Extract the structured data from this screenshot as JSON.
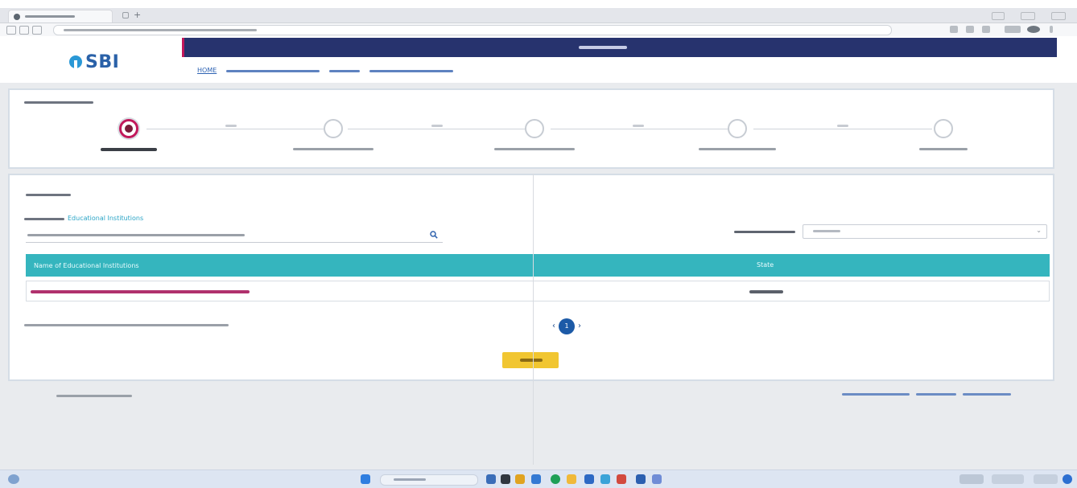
{
  "header": {
    "logo_text": "SBI",
    "home_label": "HOME"
  },
  "payee": {
    "category_value": "Educational Institutions"
  },
  "table": {
    "col_name": "Name of Educational Institutions",
    "col_state": "State"
  },
  "pager": {
    "prev": "‹",
    "page": "1",
    "next": "›"
  },
  "select_caret": "⌄"
}
